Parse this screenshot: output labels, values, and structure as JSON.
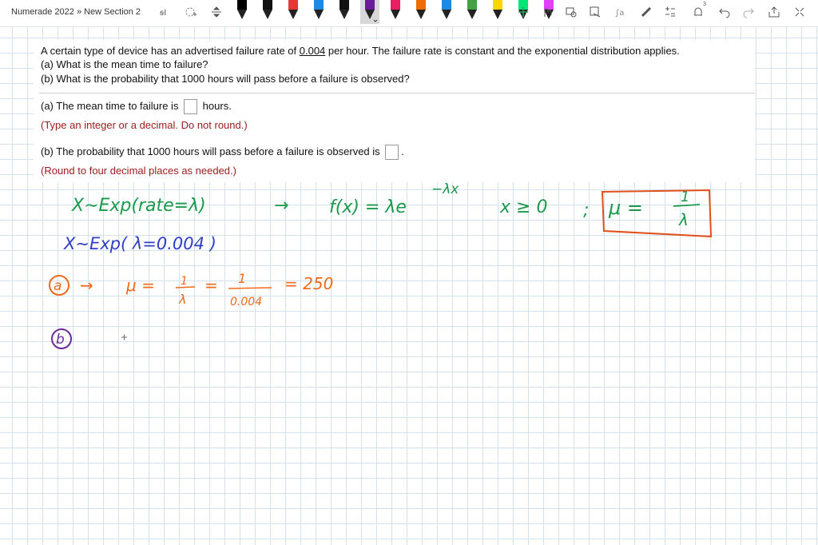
{
  "toolbar": {
    "breadcrumb": "Numerade 2022 » New Section 2",
    "tools": [
      "lasso-select-icon",
      "add-space-icon",
      "insert-space-icon",
      "plus-icon",
      "ruler-icon",
      "eraser-icon",
      "undo-icon",
      "redo-icon",
      "share-icon",
      "fullscreen-icon"
    ],
    "pens": [
      {
        "color": "#000000",
        "selected": false
      },
      {
        "color": "#111111",
        "selected": false
      },
      {
        "color": "#e53935",
        "selected": false
      },
      {
        "color": "#1e88e5",
        "selected": false
      },
      {
        "color": "#111111",
        "selected": false
      },
      {
        "color": "#6a1b9a",
        "selected": true
      },
      {
        "color": "#e91e63",
        "selected": false
      },
      {
        "color": "#ef6c00",
        "selected": false
      },
      {
        "color": "#1e88e5",
        "selected": false
      },
      {
        "color": "#43a047",
        "selected": false
      },
      {
        "color": "#ffd600",
        "selected": false
      },
      {
        "color": "#00e676",
        "selected": false
      },
      {
        "color": "#e040fb",
        "selected": false
      }
    ],
    "page_count_badge": "3"
  },
  "problem": {
    "line1_pre": "A certain type of device has an advertised failure rate of ",
    "line1_rate": "0.004",
    "line1_post": " per hour. The failure rate is constant and the exponential distribution applies.",
    "line2": "(a) What is the mean time to failure?",
    "line3": "(b) What is the probability that 1000 hours will pass before a failure is observed?",
    "part_a_pre": "(a) The mean time to failure is ",
    "part_a_post": " hours.",
    "part_a_hint": "(Type an integer or a decimal. Do not round.)",
    "part_b_pre": "(b) The probability that 1000 hours will pass before a failure is observed is ",
    "part_b_post": ".",
    "part_b_hint": "(Round to four decimal places as needed.)"
  },
  "handwriting": {
    "green_line1_a": "X∼Exp(rate=λ)",
    "green_arrow": "→",
    "green_pdf": "f(x) =  λe",
    "green_exponent": "−λx",
    "green_domain": "x ≥ 0",
    "green_semicolon": ";",
    "boxed_mu": "μ =",
    "boxed_num": "1",
    "boxed_den": "λ",
    "blue_line2": "X∼Exp( λ=0.004 )",
    "orange_a_label": "a",
    "orange_arrow": "→",
    "orange_mu": "μ =",
    "orange_frac1_num": "1",
    "orange_frac1_den": "λ",
    "orange_eq": "=",
    "orange_frac2_num": "1",
    "orange_frac2_den": "0.004",
    "orange_result": "= 250",
    "purple_b_label": "b"
  },
  "colors": {
    "green_ink": "#1a9a4a",
    "blue_ink": "#2f3fc8",
    "orange_ink": "#f06a1a",
    "purple_ink": "#6a2a9a",
    "hint_red": "#9b1b1b"
  }
}
